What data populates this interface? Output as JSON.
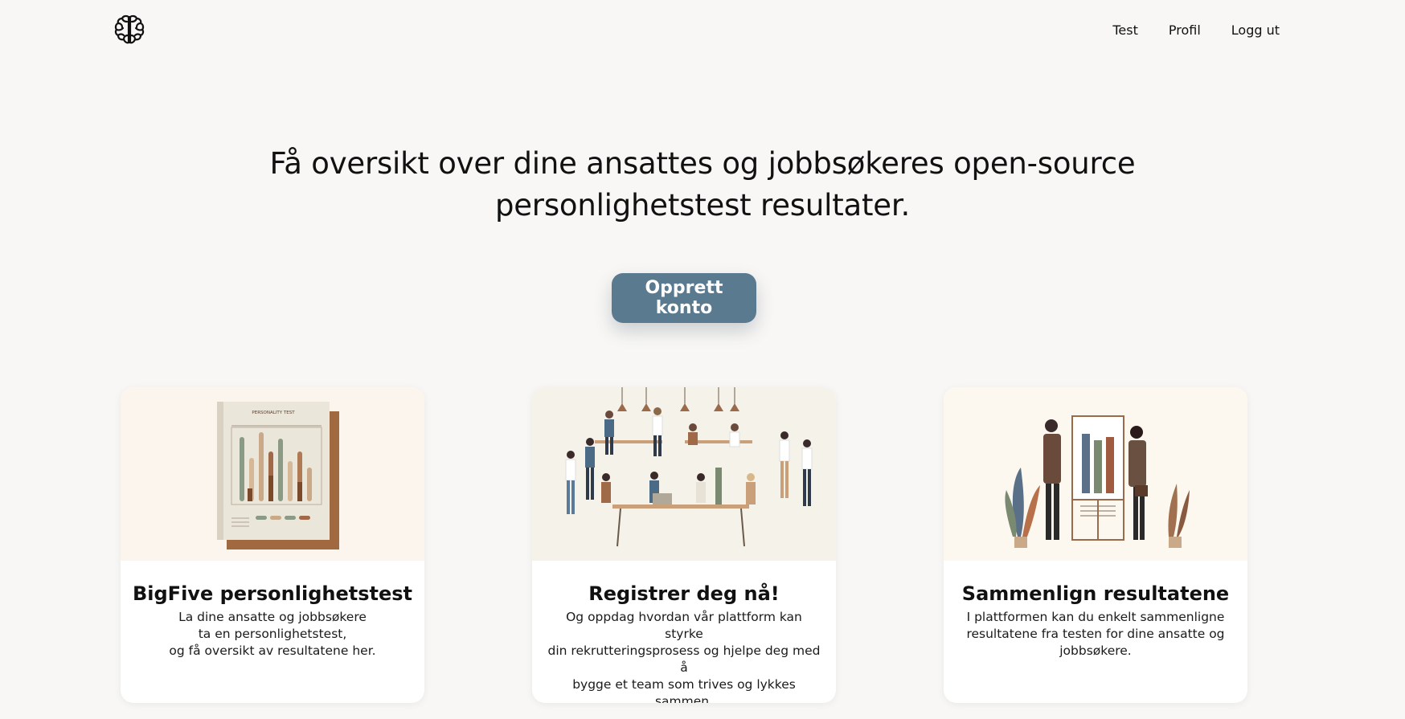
{
  "nav": {
    "logo_icon": "brain-icon",
    "items": [
      {
        "label": "Test"
      },
      {
        "label": "Profil"
      },
      {
        "label": "Logg ut"
      }
    ]
  },
  "hero": {
    "title": "Få oversikt over dine ansattes og jobbsøkeres open-source personlighetstest resultater.",
    "cta_label": "Opprett konto",
    "cta_color": "#5a7a90"
  },
  "cards": [
    {
      "illustration": "personality-test-report-illustration",
      "illustration_text": "PERSONALITY TEST",
      "title": "BigFive personlighetstest",
      "lines": [
        "La dine ansatte og jobbsøkere",
        "ta en personlighetstest,",
        "og få oversikt av resultatene her."
      ]
    },
    {
      "illustration": "team-workspace-illustration",
      "title": "Registrer deg nå!",
      "lines": [
        "Og oppdag hvordan vår plattform kan styrke",
        "din rekrutteringsprosess og hjelpe deg med å",
        "bygge et team som trives og lykkes sammen."
      ]
    },
    {
      "illustration": "people-comparing-chart-illustration",
      "title": "Sammenlign resultatene",
      "lines": [
        "I plattformen kan du enkelt sammenligne",
        "resultatene fra testen for dine ansatte og",
        "jobbsøkere."
      ]
    }
  ]
}
